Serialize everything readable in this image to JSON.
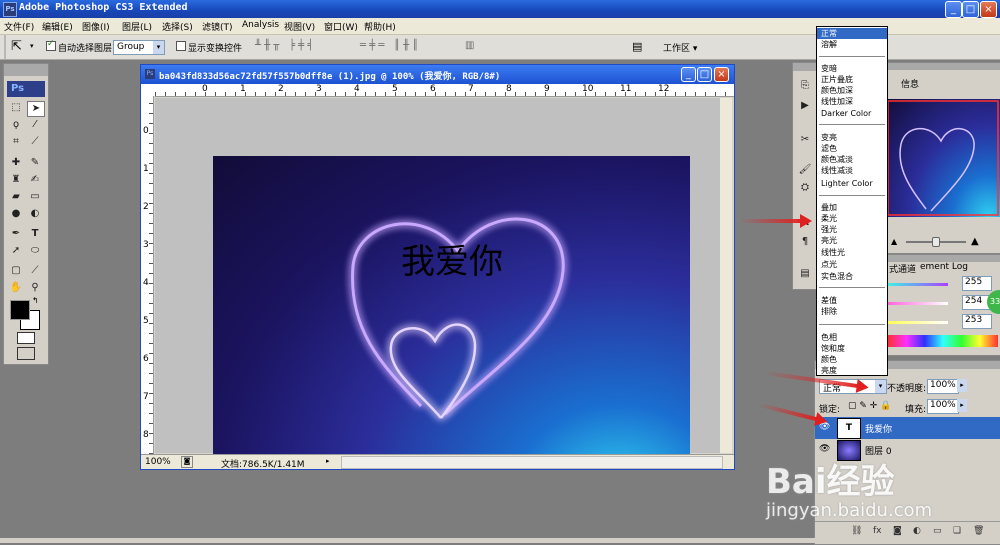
{
  "app": {
    "title": "Adobe Photoshop CS3 Extended",
    "logo": "Ps"
  },
  "menu": [
    "文件(F)",
    "编辑(E)",
    "图像(I)",
    "图层(L)",
    "选择(S)",
    "滤镜(T)",
    "Analysis",
    "视图(V)",
    "窗口(W)",
    "帮助(H)"
  ],
  "options": {
    "auto_select_label": "自动选择图层",
    "auto_select_checked": true,
    "group_value": "Group",
    "show_transform_label": "显示变换控件",
    "show_transform_checked": false,
    "workspace_label": "工作区"
  },
  "document": {
    "title": "ba043fd833d56ac72fd57f557b0dff8e (1).jpg @ 100% (我爱你, RGB/8#)",
    "canvas_text": "我爱你",
    "zoom": "100%",
    "doc_size": "文档:786.5K/1.41M",
    "ruler_h_labels": [
      "0",
      "1",
      "2",
      "3",
      "4",
      "5",
      "6",
      "7",
      "8",
      "9",
      "10",
      "11",
      "12"
    ],
    "ruler_v_labels": [
      "0",
      "1",
      "2",
      "3",
      "4",
      "5",
      "6",
      "7",
      "8"
    ]
  },
  "navigator": {
    "tab_info": "信息"
  },
  "channels": {
    "tabs": [
      "式",
      "通道",
      "ement Log"
    ],
    "values": [
      "255",
      "254",
      "253"
    ]
  },
  "blend_menu": {
    "groups": [
      [
        "正常",
        "溶解"
      ],
      [
        "变暗",
        "正片叠底",
        "颜色加深",
        "线性加深",
        "Darker Color"
      ],
      [
        "变亮",
        "滤色",
        "颜色减淡",
        "线性减淡",
        "Lighter Color"
      ],
      [
        "叠加",
        "柔光",
        "强光",
        "亮光",
        "线性光",
        "点光",
        "实色混合"
      ],
      [
        "差值",
        "排除"
      ],
      [
        "色相",
        "饱和度",
        "颜色",
        "亮度"
      ]
    ],
    "selected": "正常"
  },
  "layers": {
    "blend_mode": "正常",
    "opacity_label": "不透明度:",
    "opacity_value": "100%",
    "lock_label": "锁定:",
    "fill_label": "填充:",
    "fill_value": "100%",
    "items": [
      {
        "name": "我爱你",
        "type": "text",
        "thumb": "T",
        "selected": true
      },
      {
        "name": "图层 0",
        "type": "image",
        "thumb": "",
        "selected": false
      }
    ]
  },
  "watermark": {
    "brand": "Bai经验",
    "url": "jingyan.baidu.com"
  },
  "colors": {
    "titlebar": "#1d52d2",
    "arrow": "#e02020",
    "selection": "#316ac5"
  },
  "icons": {
    "move_tool": "move-icon",
    "close": "close-icon",
    "eye": "eye-icon"
  }
}
